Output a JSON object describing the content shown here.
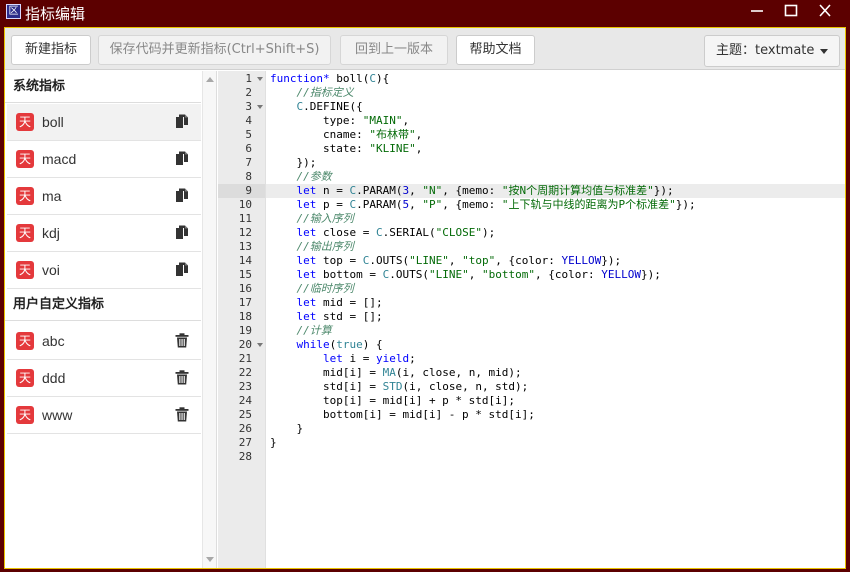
{
  "window": {
    "title": "指标编辑",
    "icon_glyph": "区",
    "controls": [
      "minimize-icon",
      "maximize-icon",
      "close-icon"
    ]
  },
  "toolbar": {
    "new_label": "新建指标",
    "save_label": "保存代码并更新指标(Ctrl+Shift+S)",
    "revert_label": "回到上一版本",
    "help_label": "帮助文档",
    "theme_label": "主题：",
    "theme_value": "textmate"
  },
  "sidebar": {
    "system_title": "系统指标",
    "user_title": "用户自定义指标",
    "badge_glyph": "天",
    "system_items": [
      {
        "label": "boll",
        "icon": "copy-icon",
        "active": true
      },
      {
        "label": "macd",
        "icon": "copy-icon",
        "active": false
      },
      {
        "label": "ma",
        "icon": "copy-icon",
        "active": false
      },
      {
        "label": "kdj",
        "icon": "copy-icon",
        "active": false
      },
      {
        "label": "voi",
        "icon": "copy-icon",
        "active": false
      }
    ],
    "user_items": [
      {
        "label": "abc",
        "icon": "trash-icon"
      },
      {
        "label": "ddd",
        "icon": "trash-icon"
      },
      {
        "label": "www",
        "icon": "trash-icon"
      }
    ]
  },
  "editor": {
    "active_line": 9,
    "fold_lines": [
      1,
      3,
      20
    ],
    "lines": [
      [
        [
          "keyword",
          "function*"
        ],
        [
          "plain",
          " boll("
        ],
        [
          "const",
          "C"
        ],
        [
          "plain",
          "){"
        ]
      ],
      [
        [
          "plain",
          "    "
        ],
        [
          "comment",
          "//指标定义"
        ]
      ],
      [
        [
          "plain",
          "    "
        ],
        [
          "const",
          "C"
        ],
        [
          "plain",
          ".DEFINE({"
        ]
      ],
      [
        [
          "plain",
          "        type: "
        ],
        [
          "string",
          "\"MAIN\""
        ],
        [
          "plain",
          ","
        ]
      ],
      [
        [
          "plain",
          "        cname: "
        ],
        [
          "string",
          "\"布林带\""
        ],
        [
          "plain",
          ","
        ]
      ],
      [
        [
          "plain",
          "        state: "
        ],
        [
          "string",
          "\"KLINE\""
        ],
        [
          "plain",
          ","
        ]
      ],
      [
        [
          "plain",
          "    });"
        ]
      ],
      [
        [
          "plain",
          "    "
        ],
        [
          "comment",
          "//参数"
        ]
      ],
      [
        [
          "plain",
          "    "
        ],
        [
          "keyword",
          "let"
        ],
        [
          "plain",
          " n = "
        ],
        [
          "const",
          "C"
        ],
        [
          "plain",
          ".PARAM("
        ],
        [
          "number",
          "3"
        ],
        [
          "plain",
          ", "
        ],
        [
          "string",
          "\"N\""
        ],
        [
          "plain",
          ", {memo: "
        ],
        [
          "string",
          "\"按N个周期计算均值与标准差\""
        ],
        [
          "plain",
          "});"
        ]
      ],
      [
        [
          "plain",
          "    "
        ],
        [
          "keyword",
          "let"
        ],
        [
          "plain",
          " p = "
        ],
        [
          "const",
          "C"
        ],
        [
          "plain",
          ".PARAM("
        ],
        [
          "number",
          "5"
        ],
        [
          "plain",
          ", "
        ],
        [
          "string",
          "\"P\""
        ],
        [
          "plain",
          ", {memo: "
        ],
        [
          "string",
          "\"上下轨与中线的距离为P个标准差\""
        ],
        [
          "plain",
          "});"
        ]
      ],
      [
        [
          "plain",
          "    "
        ],
        [
          "comment",
          "//输入序列"
        ]
      ],
      [
        [
          "plain",
          "    "
        ],
        [
          "keyword",
          "let"
        ],
        [
          "plain",
          " close = "
        ],
        [
          "const",
          "C"
        ],
        [
          "plain",
          ".SERIAL("
        ],
        [
          "string",
          "\"CLOSE\""
        ],
        [
          "plain",
          ");"
        ]
      ],
      [
        [
          "plain",
          "    "
        ],
        [
          "comment",
          "//输出序列"
        ]
      ],
      [
        [
          "plain",
          "    "
        ],
        [
          "keyword",
          "let"
        ],
        [
          "plain",
          " top = "
        ],
        [
          "const",
          "C"
        ],
        [
          "plain",
          ".OUTS("
        ],
        [
          "string",
          "\"LINE\""
        ],
        [
          "plain",
          ", "
        ],
        [
          "string",
          "\"top\""
        ],
        [
          "plain",
          ", {color: "
        ],
        [
          "number",
          "YELLOW"
        ],
        [
          "plain",
          "});"
        ]
      ],
      [
        [
          "plain",
          "    "
        ],
        [
          "keyword",
          "let"
        ],
        [
          "plain",
          " bottom = "
        ],
        [
          "const",
          "C"
        ],
        [
          "plain",
          ".OUTS("
        ],
        [
          "string",
          "\"LINE\""
        ],
        [
          "plain",
          ", "
        ],
        [
          "string",
          "\"bottom\""
        ],
        [
          "plain",
          ", {color: "
        ],
        [
          "number",
          "YELLOW"
        ],
        [
          "plain",
          "});"
        ]
      ],
      [
        [
          "plain",
          "    "
        ],
        [
          "comment",
          "//临时序列"
        ]
      ],
      [
        [
          "plain",
          "    "
        ],
        [
          "keyword",
          "let"
        ],
        [
          "plain",
          " mid = [];"
        ]
      ],
      [
        [
          "plain",
          "    "
        ],
        [
          "keyword",
          "let"
        ],
        [
          "plain",
          " std = [];"
        ]
      ],
      [
        [
          "plain",
          "    "
        ],
        [
          "comment",
          "//计算"
        ]
      ],
      [
        [
          "plain",
          "    "
        ],
        [
          "keyword",
          "while"
        ],
        [
          "plain",
          "("
        ],
        [
          "const",
          "true"
        ],
        [
          "plain",
          ") {"
        ]
      ],
      [
        [
          "plain",
          "        "
        ],
        [
          "keyword",
          "let"
        ],
        [
          "plain",
          " i = "
        ],
        [
          "keyword",
          "yield"
        ],
        [
          "plain",
          ";"
        ]
      ],
      [
        [
          "plain",
          "        mid[i] = "
        ],
        [
          "const",
          "MA"
        ],
        [
          "plain",
          "(i, close, n, mid);"
        ]
      ],
      [
        [
          "plain",
          "        std[i] = "
        ],
        [
          "const",
          "STD"
        ],
        [
          "plain",
          "(i, close, n, std);"
        ]
      ],
      [
        [
          "plain",
          "        top[i] = mid[i] + p * std[i];"
        ]
      ],
      [
        [
          "plain",
          "        bottom[i] = mid[i] - p * std[i];"
        ]
      ],
      [
        [
          "plain",
          "    }"
        ]
      ],
      [
        [
          "plain",
          "}"
        ]
      ],
      [
        [
          "plain",
          ""
        ]
      ]
    ]
  }
}
